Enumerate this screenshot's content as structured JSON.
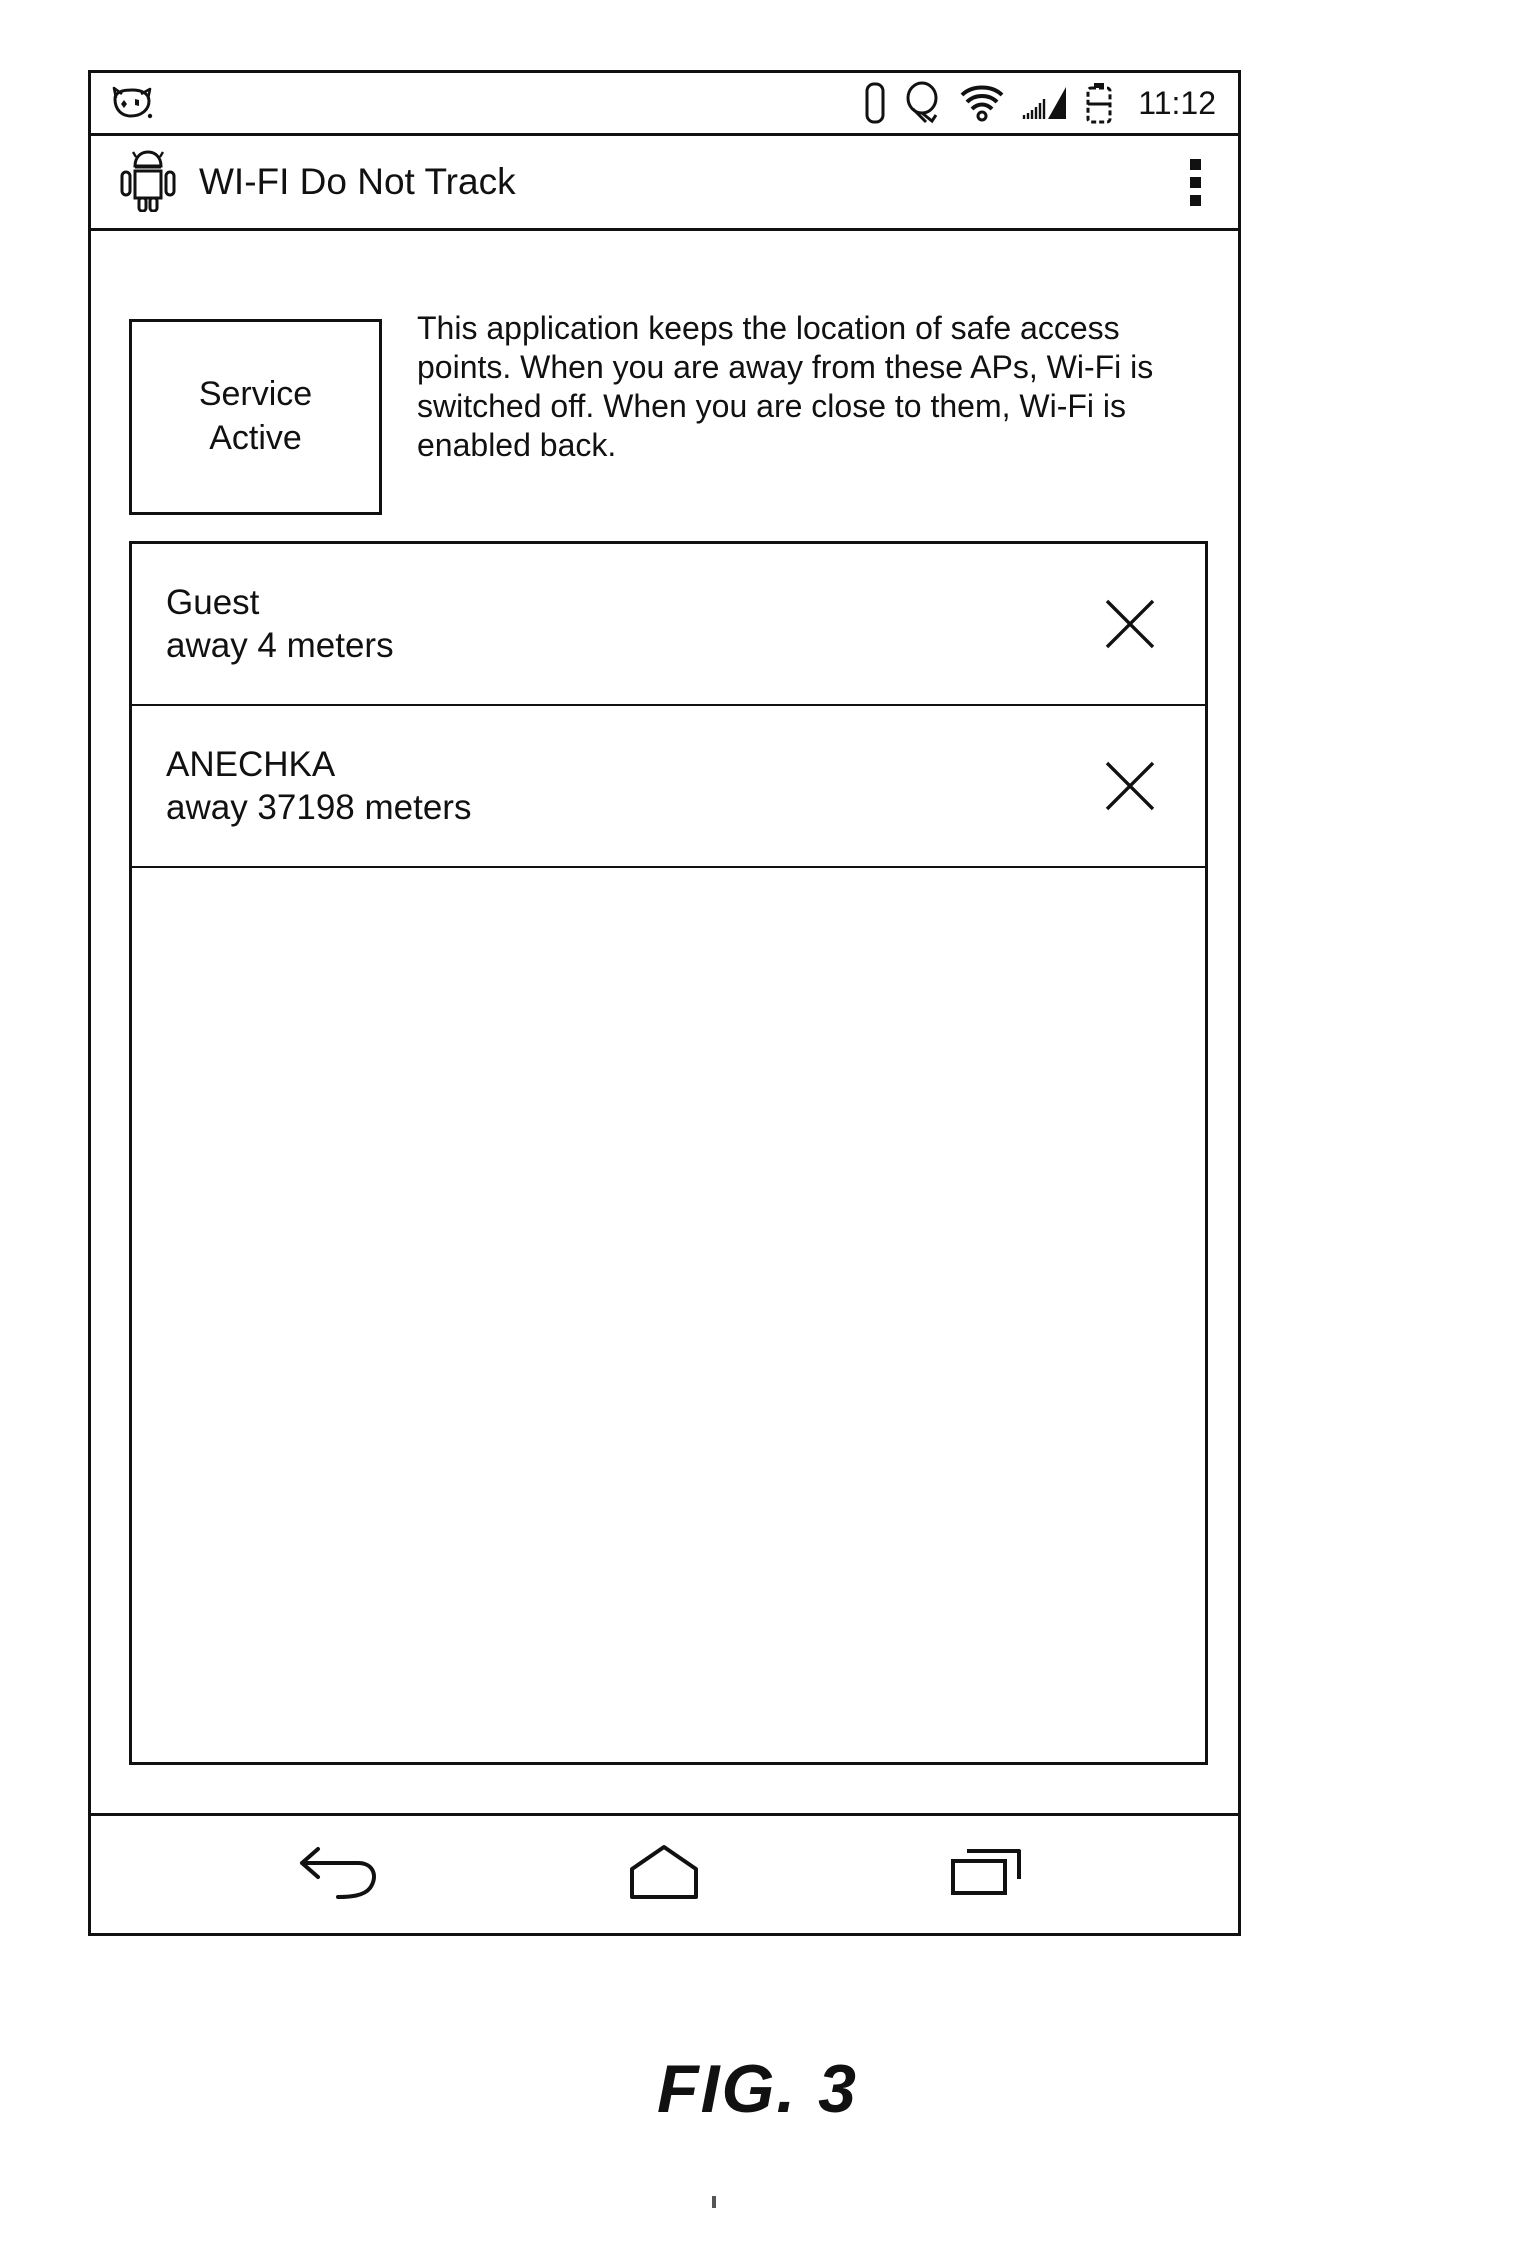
{
  "figure": {
    "caption": "FIG. 3"
  },
  "status_bar": {
    "time": "11:12",
    "notification_icon": "app-notification-icon",
    "icons": [
      "sim-card-icon",
      "headset-icon",
      "wifi-signal-icon",
      "cellular-signal-icon",
      "battery-icon"
    ]
  },
  "action_bar": {
    "app_icon": "android-robot-icon",
    "title": "WI-FI Do Not Track",
    "overflow_icon": "overflow-menu-icon"
  },
  "content": {
    "service_status": {
      "line1": "Service",
      "line2": "Active"
    },
    "description": "This application keeps the location of safe access points. When you are away from these APs, Wi-Fi is switched off. When you are close to them, Wi-Fi is enabled back.",
    "access_points": [
      {
        "name": "Guest",
        "distance": "away 4 meters",
        "remove_icon": "close-icon"
      },
      {
        "name": "ANECHKA",
        "distance": "away 37198 meters",
        "remove_icon": "close-icon"
      }
    ]
  },
  "nav_bar": {
    "buttons": [
      {
        "name": "back-button",
        "icon": "back-arrow-icon"
      },
      {
        "name": "home-button",
        "icon": "home-icon"
      },
      {
        "name": "recents-button",
        "icon": "recents-icon"
      }
    ]
  },
  "colors": {
    "line": "#111111",
    "background": "#ffffff"
  }
}
